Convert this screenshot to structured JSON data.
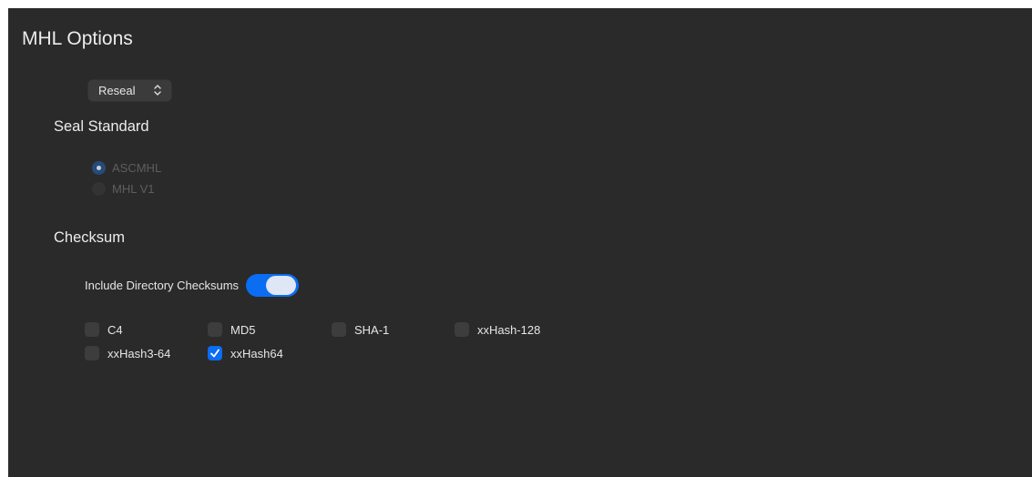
{
  "title": "MHL Options",
  "mode_popup": {
    "selected": "Reseal",
    "icon": "up-down-chevron-icon"
  },
  "seal_standard": {
    "heading": "Seal Standard",
    "options": [
      {
        "label": "ASCMHL",
        "selected": true,
        "enabled": false
      },
      {
        "label": "MHL V1",
        "selected": false,
        "enabled": false
      }
    ]
  },
  "checksum": {
    "heading": "Checksum",
    "include_directory_label": "Include Directory Checksums",
    "include_directory_on": true,
    "algorithms": [
      {
        "label": "C4",
        "checked": false
      },
      {
        "label": "MD5",
        "checked": false
      },
      {
        "label": "SHA-1",
        "checked": false
      },
      {
        "label": "xxHash-128",
        "checked": false
      },
      {
        "label": "xxHash3-64",
        "checked": false
      },
      {
        "label": "xxHash64",
        "checked": true
      }
    ]
  },
  "colors": {
    "panel_background": "#2a2a2a",
    "accent": "#0a6df2",
    "disabled_text": "#5e5e5e"
  }
}
